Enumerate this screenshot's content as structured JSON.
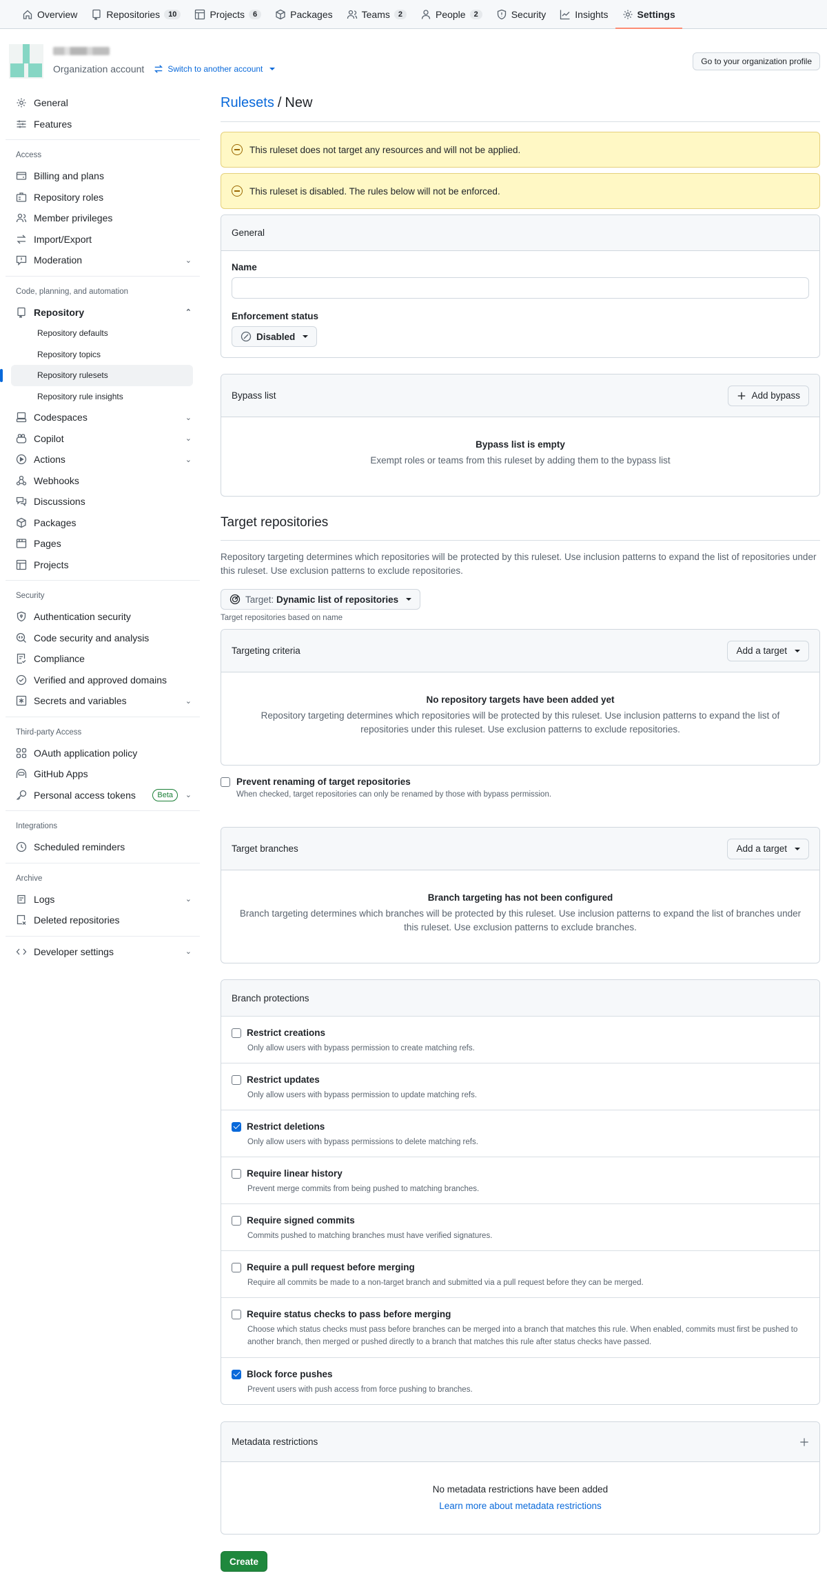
{
  "topnav": {
    "items": [
      {
        "label": "Overview",
        "icon": "home-icon"
      },
      {
        "label": "Repositories",
        "count": "10",
        "icon": "repo-icon"
      },
      {
        "label": "Projects",
        "count": "6",
        "icon": "table-icon"
      },
      {
        "label": "Packages",
        "icon": "package-icon"
      },
      {
        "label": "Teams",
        "count": "2",
        "icon": "people-icon"
      },
      {
        "label": "People",
        "count": "2",
        "icon": "person-icon"
      },
      {
        "label": "Security",
        "icon": "shield-icon"
      },
      {
        "label": "Insights",
        "icon": "graph-icon"
      },
      {
        "label": "Settings",
        "icon": "gear-icon",
        "active": true
      }
    ]
  },
  "org": {
    "account_type": "Organization account",
    "switch_label": "Switch to another account",
    "profile_button": "Go to your organization profile"
  },
  "sidebar": {
    "general": "General",
    "features": "Features",
    "access_heading": "Access",
    "billing": "Billing and plans",
    "repo_roles": "Repository roles",
    "member_privileges": "Member privileges",
    "import_export": "Import/Export",
    "moderation": "Moderation",
    "code_heading": "Code, planning, and automation",
    "repository": "Repository",
    "repo_defaults": "Repository defaults",
    "repo_topics": "Repository topics",
    "repo_rulesets": "Repository rulesets",
    "repo_rule_insights": "Repository rule insights",
    "codespaces": "Codespaces",
    "copilot": "Copilot",
    "actions": "Actions",
    "webhooks": "Webhooks",
    "discussions": "Discussions",
    "packages": "Packages",
    "pages": "Pages",
    "projects": "Projects",
    "security_heading": "Security",
    "auth_security": "Authentication security",
    "code_security": "Code security and analysis",
    "compliance": "Compliance",
    "verified_domains": "Verified and approved domains",
    "secrets": "Secrets and variables",
    "thirdparty_heading": "Third-party Access",
    "oauth": "OAuth application policy",
    "github_apps": "GitHub Apps",
    "pat": "Personal access tokens",
    "pat_badge": "Beta",
    "integrations_heading": "Integrations",
    "scheduled_reminders": "Scheduled reminders",
    "archive_heading": "Archive",
    "logs": "Logs",
    "deleted_repos": "Deleted repositories",
    "developer_settings": "Developer settings"
  },
  "main": {
    "breadcrumb_link": "Rulesets",
    "breadcrumb_sep": "/",
    "breadcrumb_current": "New",
    "alerts": [
      "This ruleset does not target any resources and will not be applied.",
      "This ruleset is disabled. The rules below will not be enforced."
    ],
    "general": {
      "title": "General",
      "name_label": "Name",
      "name_value": "",
      "enforcement_label": "Enforcement status",
      "enforcement_value": "Disabled"
    },
    "bypass": {
      "title": "Bypass list",
      "add_button": "Add bypass",
      "empty_title": "Bypass list is empty",
      "empty_desc": "Exempt roles or teams from this ruleset by adding them to the bypass list"
    },
    "target_repos": {
      "heading": "Target repositories",
      "desc": "Repository targeting determines which repositories will be protected by this ruleset. Use inclusion patterns to expand the list of repositories under this ruleset. Use exclusion patterns to exclude repositories.",
      "target_prefix": "Target:",
      "target_value": "Dynamic list of repositories",
      "target_hint": "Target repositories based on name",
      "criteria_title": "Targeting criteria",
      "add_target": "Add a target",
      "empty_title": "No repository targets have been added yet",
      "empty_desc": "Repository targeting determines which repositories will be protected by this ruleset. Use inclusion patterns to expand the list of repositories under this ruleset. Use exclusion patterns to exclude repositories.",
      "prevent_label": "Prevent renaming of target repositories",
      "prevent_desc": "When checked, target repositories can only be renamed by those with bypass permission.",
      "prevent_checked": false
    },
    "target_branches": {
      "title": "Target branches",
      "add_target": "Add a target",
      "empty_title": "Branch targeting has not been configured",
      "empty_desc": "Branch targeting determines which branches will be protected by this ruleset. Use inclusion patterns to expand the list of branches under this ruleset. Use exclusion patterns to exclude branches."
    },
    "branch_protections": {
      "title": "Branch protections",
      "rules": [
        {
          "name": "Restrict creations",
          "desc": "Only allow users with bypass permission to create matching refs.",
          "checked": false
        },
        {
          "name": "Restrict updates",
          "desc": "Only allow users with bypass permission to update matching refs.",
          "checked": false
        },
        {
          "name": "Restrict deletions",
          "desc": "Only allow users with bypass permissions to delete matching refs.",
          "checked": true
        },
        {
          "name": "Require linear history",
          "desc": "Prevent merge commits from being pushed to matching branches.",
          "checked": false
        },
        {
          "name": "Require signed commits",
          "desc": "Commits pushed to matching branches must have verified signatures.",
          "checked": false
        },
        {
          "name": "Require a pull request before merging",
          "desc": "Require all commits be made to a non-target branch and submitted via a pull request before they can be merged.",
          "checked": false
        },
        {
          "name": "Require status checks to pass before merging",
          "desc": "Choose which status checks must pass before branches can be merged into a branch that matches this rule. When enabled, commits must first be pushed to another branch, then merged or pushed directly to a branch that matches this rule after status checks have passed.",
          "checked": false
        },
        {
          "name": "Block force pushes",
          "desc": "Prevent users with push access from force pushing to branches.",
          "checked": true
        }
      ]
    },
    "metadata": {
      "title": "Metadata restrictions",
      "empty_title": "No metadata restrictions have been added",
      "learn_more": "Learn more about metadata restrictions"
    },
    "create_button": "Create"
  },
  "colors": {
    "accent": "#0969da",
    "active_tab_underline": "#fd8c73",
    "alert_bg": "#fff8c5",
    "create_green": "#1f883d",
    "beta_green": "#1a7f37"
  }
}
